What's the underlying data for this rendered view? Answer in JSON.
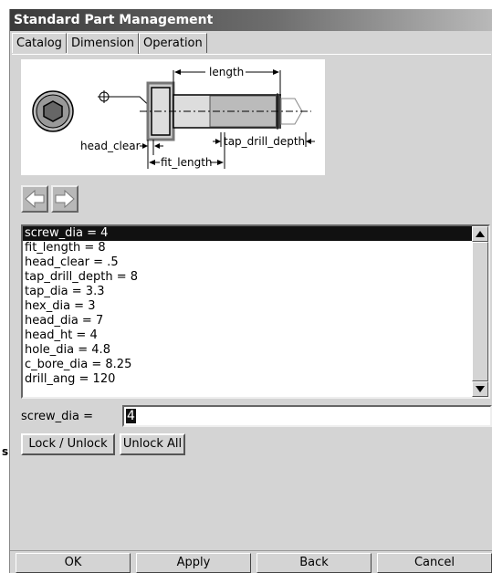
{
  "window": {
    "title": "Standard Part Management"
  },
  "tabs": [
    {
      "label": "Catalog"
    },
    {
      "label": "Dimension"
    },
    {
      "label": "Operation"
    }
  ],
  "diagram": {
    "labels": {
      "length": "length",
      "head_clear": "head_clear",
      "fit_length": "fit_length",
      "tap_drill_depth": "tap_drill_depth"
    }
  },
  "nav": {
    "back_icon": "left-arrow-icon",
    "forward_icon": "right-arrow-icon"
  },
  "dimensions": [
    "screw_dia = 4",
    "fit_length = 8",
    "head_clear = .5",
    "tap_drill_depth = 8",
    "tap_dia = 3.3",
    "hex_dia = 3",
    "head_dia = 7",
    "head_ht = 4",
    "hole_dia = 4.8",
    "c_bore_dia = 8.25",
    "drill_ang = 120"
  ],
  "editor": {
    "label": "screw_dia =",
    "value": "4"
  },
  "buttons": {
    "lock_unlock": "Lock / Unlock",
    "unlock_all": "Unlock All"
  },
  "footer": {
    "ok": "OK",
    "apply": "Apply",
    "back": "Back",
    "cancel": "Cancel"
  },
  "side_mark": "s"
}
